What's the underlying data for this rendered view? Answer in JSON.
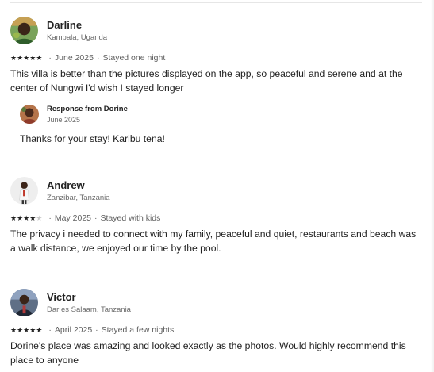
{
  "reviews": [
    {
      "name": "Darline",
      "location": "Kampala, Uganda",
      "rating": 5,
      "date": "June 2025",
      "stay": "Stayed one night",
      "text": "This villa is better than the pictures displayed on the app, so peaceful and serene and at the center of Nungwi I'd wish I stayed longer",
      "avatar_icon": "person-photo-icon",
      "response": {
        "title": "Response from Dorine",
        "date": "June 2025",
        "text": "Thanks for your stay! Karibu tena!"
      }
    },
    {
      "name": "Andrew",
      "location": "Zanzibar, Tanzania",
      "rating": 4,
      "date": "May 2025",
      "stay": "Stayed with kids",
      "text": "The privacy i needed to connect with my family, peaceful and quiet, restaurants and beach was a walk distance, we enjoyed our time by the pool.",
      "avatar_icon": "person-photo-icon"
    },
    {
      "name": "Victor",
      "location": "Dar es Salaam, Tanzania",
      "rating": 5,
      "date": "April 2025",
      "stay": "Stayed a few nights",
      "text": "Dorine's place was amazing and looked exactly as the photos. Would highly recommend this place to anyone",
      "avatar_icon": "person-photo-icon"
    }
  ],
  "separator": "·",
  "colors": {
    "text": "#222222",
    "muted": "#6a6a6a",
    "divider": "#e6e6e6",
    "star_filled": "#222222",
    "star_empty": "#c8c8c8"
  }
}
